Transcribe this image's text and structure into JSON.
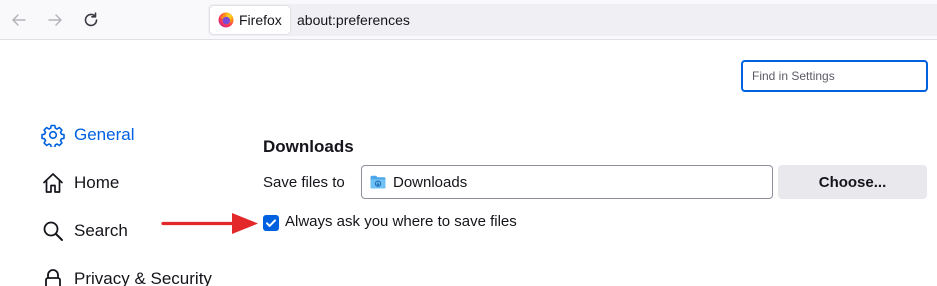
{
  "toolbar": {
    "back_icon": "back-arrow-icon",
    "forward_icon": "forward-arrow-icon",
    "reload_icon": "reload-icon"
  },
  "urlbar": {
    "identity_label": "Firefox",
    "url": "about:preferences"
  },
  "search": {
    "placeholder": "Find in Settings",
    "value": ""
  },
  "sidebar": {
    "items": [
      {
        "label": "General",
        "icon": "gear-icon",
        "selected": true
      },
      {
        "label": "Home",
        "icon": "home-icon",
        "selected": false
      },
      {
        "label": "Search",
        "icon": "search-icon",
        "selected": false
      },
      {
        "label": "Privacy & Security",
        "icon": "lock-icon",
        "selected": false
      }
    ]
  },
  "downloads": {
    "title": "Downloads",
    "save_label": "Save files to",
    "folder": "Downloads",
    "choose_button": "Choose...",
    "always_ask_label": "Always ask you where to save files",
    "always_ask_checked": true
  },
  "colors": {
    "accent": "#0061e0",
    "annotation": "#e22828"
  }
}
